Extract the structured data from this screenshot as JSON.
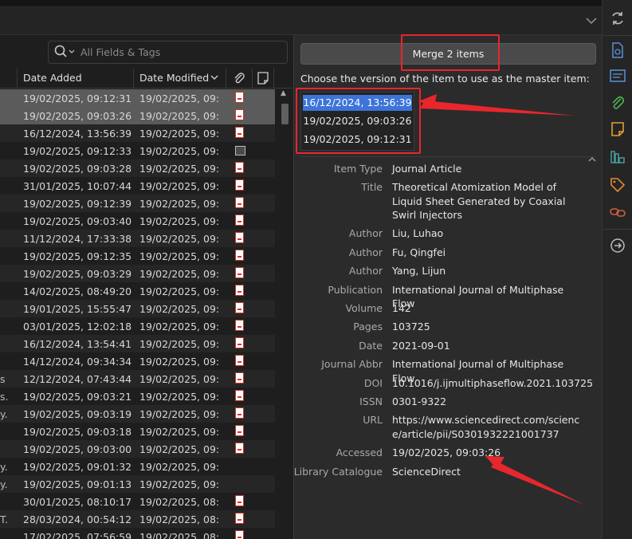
{
  "search": {
    "placeholder": "All Fields & Tags"
  },
  "table": {
    "columns": {
      "date_added": "Date Added",
      "date_modified": "Date Modified",
      "chevron": "⌄"
    },
    "rows": [
      {
        "pre": "",
        "added": "19/02/2025, 09:12:31",
        "modified": "19/02/2025, 09:...",
        "att": "pdf",
        "state": "sel"
      },
      {
        "pre": "",
        "added": "19/02/2025, 09:03:26",
        "modified": "19/02/2025, 09:...",
        "att": "pdf",
        "state": "sel"
      },
      {
        "pre": "",
        "added": "16/12/2024, 13:56:39",
        "modified": "19/02/2025, 09:...",
        "att": "pdf",
        "state": "alt"
      },
      {
        "pre": "",
        "added": "19/02/2025, 09:12:33",
        "modified": "19/02/2025, 09:...",
        "att": "snapshot",
        "state": ""
      },
      {
        "pre": "",
        "added": "19/02/2025, 09:03:28",
        "modified": "19/02/2025, 09:...",
        "att": "pdf",
        "state": "alt"
      },
      {
        "pre": "",
        "added": "31/01/2025, 10:07:44",
        "modified": "19/02/2025, 09:...",
        "att": "pdf",
        "state": ""
      },
      {
        "pre": "",
        "added": "19/02/2025, 09:12:39",
        "modified": "19/02/2025, 09:...",
        "att": "pdf",
        "state": "alt"
      },
      {
        "pre": "",
        "added": "19/02/2025, 09:03:40",
        "modified": "19/02/2025, 09:...",
        "att": "pdf",
        "state": ""
      },
      {
        "pre": "",
        "added": "11/12/2024, 17:33:38",
        "modified": "19/02/2025, 09:...",
        "att": "pdf",
        "state": "alt"
      },
      {
        "pre": "",
        "added": "19/02/2025, 09:12:35",
        "modified": "19/02/2025, 09:...",
        "att": "pdf",
        "state": ""
      },
      {
        "pre": "",
        "added": "19/02/2025, 09:03:29",
        "modified": "19/02/2025, 09:...",
        "att": "pdf",
        "state": "alt"
      },
      {
        "pre": "",
        "added": "14/02/2025, 08:49:20",
        "modified": "19/02/2025, 09:...",
        "att": "pdf",
        "state": ""
      },
      {
        "pre": "",
        "added": "19/01/2025, 15:55:47",
        "modified": "19/02/2025, 09:...",
        "att": "pdf",
        "state": "alt"
      },
      {
        "pre": "",
        "added": "03/01/2025, 12:02:18",
        "modified": "19/02/2025, 09:...",
        "att": "pdf",
        "state": ""
      },
      {
        "pre": "",
        "added": "16/12/2024, 13:54:41",
        "modified": "19/02/2025, 09:...",
        "att": "pdf",
        "state": "alt"
      },
      {
        "pre": "",
        "added": "14/12/2024, 09:34:34",
        "modified": "19/02/2025, 09:...",
        "att": "pdf",
        "state": ""
      },
      {
        "pre": "s",
        "added": "12/12/2024, 07:43:44",
        "modified": "19/02/2025, 09:...",
        "att": "pdf",
        "state": "alt"
      },
      {
        "pre": "s.",
        "added": "19/02/2025, 09:03:21",
        "modified": "19/02/2025, 09:...",
        "att": "pdf",
        "state": ""
      },
      {
        "pre": "y.",
        "added": "19/02/2025, 09:03:19",
        "modified": "19/02/2025, 09:...",
        "att": "pdf",
        "state": "alt"
      },
      {
        "pre": "",
        "added": "19/02/2025, 09:03:18",
        "modified": "19/02/2025, 09:...",
        "att": "pdf",
        "state": ""
      },
      {
        "pre": "",
        "added": "19/02/2025, 09:03:00",
        "modified": "19/02/2025, 09:...",
        "att": "pdf",
        "state": "alt"
      },
      {
        "pre": "y.",
        "added": "19/02/2025, 09:01:32",
        "modified": "19/02/2025, 09:...",
        "att": "",
        "state": ""
      },
      {
        "pre": "y.",
        "added": "19/02/2025, 09:01:13",
        "modified": "19/02/2025, 09:...",
        "att": "",
        "state": "alt"
      },
      {
        "pre": "",
        "added": "30/01/2025, 08:10:17",
        "modified": "19/02/2025, 08:...",
        "att": "pdf",
        "state": ""
      },
      {
        "pre": "T.",
        "added": "28/03/2024, 00:54:12",
        "modified": "19/02/2025, 08:...",
        "att": "pdf",
        "state": "alt"
      },
      {
        "pre": "",
        "added": "17/02/2025, 07:56:59",
        "modified": "19/02/2025, 08:...",
        "att": "pdf",
        "state": ""
      }
    ]
  },
  "merge": {
    "button_label": "Merge 2 items",
    "instruction": "Choose the version of the item to use as the master item:",
    "versions": [
      "16/12/2024, 13:56:39",
      "19/02/2025, 09:03:26",
      "19/02/2025, 09:12:31"
    ],
    "selected_index": 0
  },
  "fields": [
    {
      "label": "Item Type",
      "value": "Journal Article",
      "lines": 1
    },
    {
      "label": "Title",
      "value": "Theoretical Atomization Model of Liquid Sheet Generated by Coaxial Swirl Injectors",
      "lines": 3
    },
    {
      "label": "Author",
      "value": "Liu, Luhao",
      "lines": 1
    },
    {
      "label": "Author",
      "value": "Fu, Qingfei",
      "lines": 1
    },
    {
      "label": "Author",
      "value": "Yang, Lijun",
      "lines": 1
    },
    {
      "label": "Publication",
      "value": "International Journal of Multiphase Flow",
      "lines": 1
    },
    {
      "label": "Volume",
      "value": "142",
      "lines": 1
    },
    {
      "label": "Pages",
      "value": "103725",
      "lines": 1
    },
    {
      "label": "Date",
      "value": "2021-09-01",
      "lines": 1
    },
    {
      "label": "Journal Abbr",
      "value": "International Journal of Multiphase Flow",
      "lines": 1
    },
    {
      "label": "DOI",
      "value": "10.1016/j.ijmultiphaseflow.2021.103725",
      "lines": 1
    },
    {
      "label": "ISSN",
      "value": "0301-9322",
      "lines": 1
    },
    {
      "label": "URL",
      "value": "https://www.sciencedirect.com/science/article/pii/S0301932221001737",
      "lines": 2
    },
    {
      "label": "Accessed",
      "value": "19/02/2025, 09:03:26",
      "lines": 1
    },
    {
      "label": "Library Catalogue",
      "value": "ScienceDirect",
      "lines": 1
    }
  ],
  "sidenav": {
    "icons": [
      "info-icon",
      "abstract-icon",
      "attachments-icon",
      "notes-icon",
      "libraries-collections-icon",
      "tags-icon",
      "related-icon",
      "locate-icon"
    ],
    "colors": {
      "info": "#5b8fd9",
      "abstract": "#5b8fd9",
      "attachments": "#4caf50",
      "notes": "#e0a030",
      "libraries": "#4aa3a3",
      "tags": "#e08a30",
      "related": "#d0603a",
      "locate": "#bdbdbd"
    }
  },
  "colors": {
    "annotation_red": "#e8262d",
    "selection_blue": "#3d74d9"
  }
}
